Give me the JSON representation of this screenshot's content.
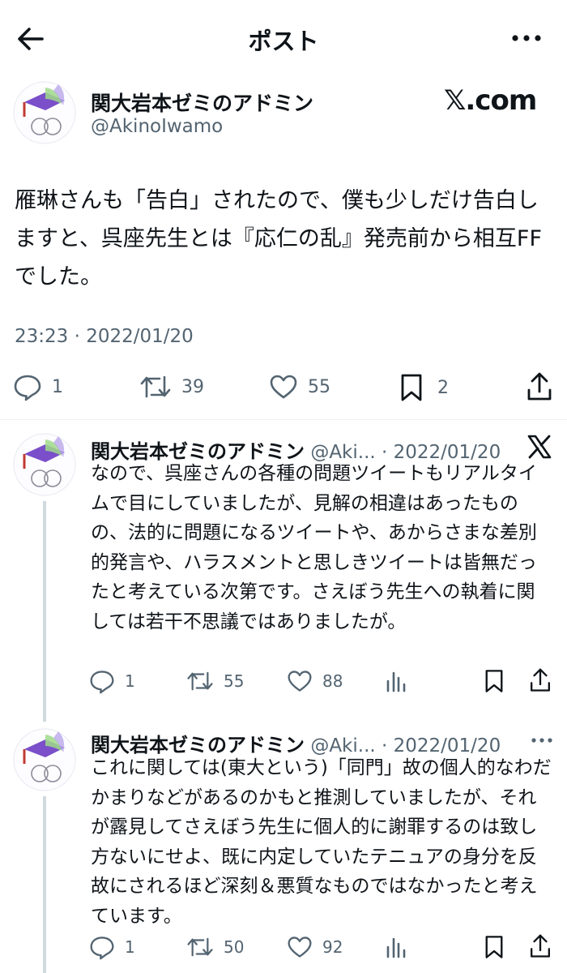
{
  "header": {
    "title": "ポスト",
    "back_icon": "arrow-left-icon",
    "more_icon": "more-horizontal-icon"
  },
  "main_post": {
    "author_name": "関大岩本ゼミのアドミン",
    "author_handle": "@AkinoIwamo",
    "source_label": "𝕏.com",
    "text": "雁琳さんも「告白」されたので、僕も少しだけ告白しますと、呉座先生とは『応仁の乱』発売前から相互FFでした。",
    "timestamp": "23:23 · 2022/01/20",
    "replies": "1",
    "reposts": "39",
    "likes": "55",
    "bookmarks": "2"
  },
  "replies": [
    {
      "author_name": "関大岩本ゼミのアドミン",
      "author_handle": "@Aki...",
      "date": "· 2022/01/20",
      "corner_icon": "x-logo-icon",
      "text": "なので、呉座さんの各種の問題ツイートもリアルタイムで目にしていましたが、見解の相違はあったものの、法的に問題になるツイートや、あからさまな差別的発言や、ハラスメントと思しきツイートは皆無だったと考えている次第です。さえぼう先生への執着に関しては若干不思議ではありましたが。",
      "replies": "1",
      "reposts": "55",
      "likes": "88"
    },
    {
      "author_name": "関大岩本ゼミのアドミン",
      "author_handle": "@Aki...",
      "date": "· 2022/01/20",
      "corner_icon": "more-icon",
      "text": "これに関しては(東大という)「同門」故の個人的なわだかまりなどがあるのかもと推測していましたが、それが露見してさえぼう先生に個人的に謝罪するのは致し方ないにせよ、既に内定していたテニュアの身分を反故にされるほど深刻＆悪質なものではなかったと考えています。",
      "replies": "1",
      "reposts": "50",
      "likes": "92"
    }
  ],
  "colors": {
    "text": "#0f1419",
    "secondary": "#536471",
    "divider": "#eff3f4",
    "thread_line": "#cfd9de"
  }
}
